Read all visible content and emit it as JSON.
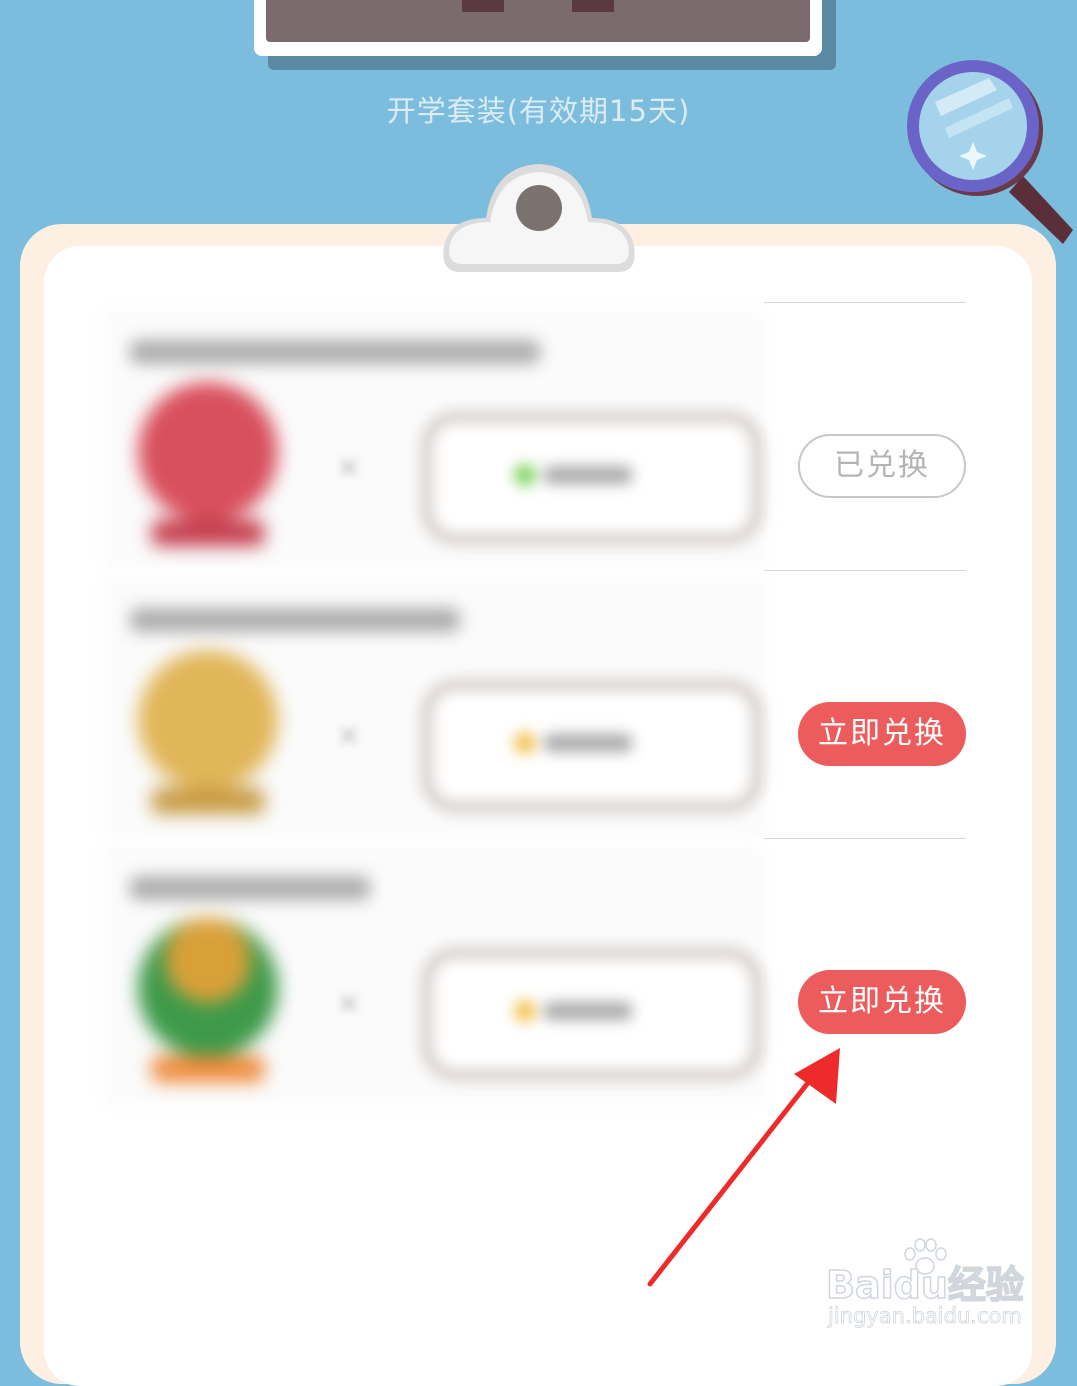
{
  "package": {
    "caption": "开学套装(有效期15天)"
  },
  "rewards": [
    {
      "button_label": "已兑换",
      "state": "redeemed",
      "badge_color": "#d8505e",
      "badge_base": "#c43e4d",
      "coupon_dot_color": "#7dd35b",
      "title_width": 410
    },
    {
      "button_label": "立即兑换",
      "state": "available",
      "badge_color": "#e0b65a",
      "badge_base": "#c79a42",
      "coupon_dot_color": "#f2c14e",
      "title_width": 330
    },
    {
      "button_label": "立即兑换",
      "state": "available",
      "badge_color": "#3e9a4a",
      "badge_base": "#f08a3a",
      "coupon_dot_color": "#f2c14e",
      "title_width": 240
    }
  ],
  "watermark": {
    "main": "Baidu经验",
    "sub": "jingyan.baidu.com"
  },
  "colors": {
    "background": "#7cbcdc",
    "accent_button": "#ec5c5c",
    "arrow": "#ee2a2a"
  }
}
